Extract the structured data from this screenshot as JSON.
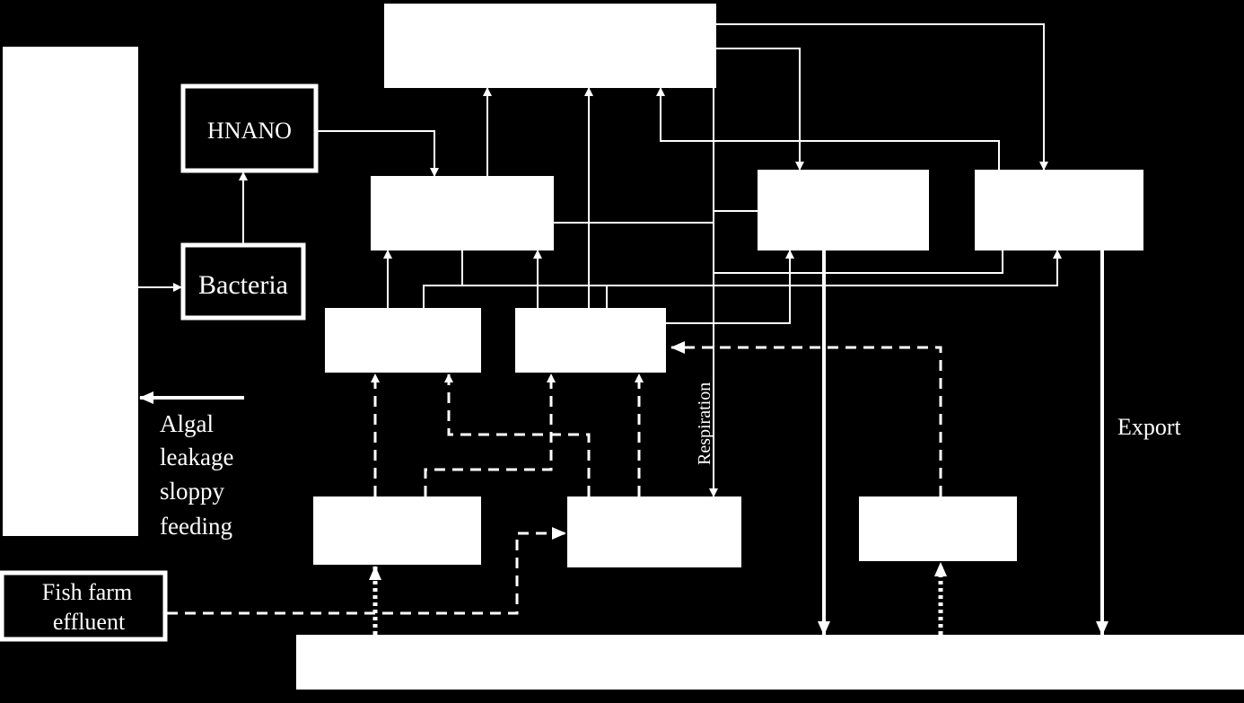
{
  "labels": {
    "hnano": "HNANO",
    "bacteria": "Bacteria",
    "algal_leakage": [
      "Algal",
      "leakage",
      "sloppy",
      "feeding"
    ],
    "fish_farm_effluent": [
      "Fish farm",
      "effluent"
    ],
    "respiration": "Respiration",
    "export": "Export"
  },
  "colors": {
    "background": "#000000",
    "foreground": "#ffffff"
  }
}
